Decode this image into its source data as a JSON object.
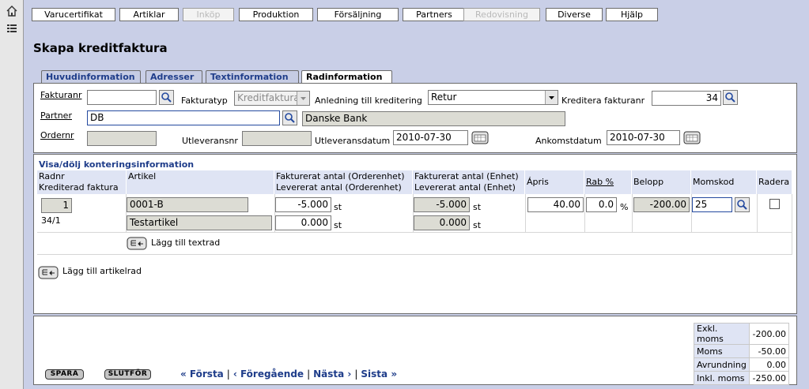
{
  "nav": [
    {
      "label": "Varucertifikat",
      "disabled": false
    },
    {
      "label": "Artiklar",
      "disabled": false
    },
    {
      "label": "Inköp",
      "disabled": true
    },
    {
      "label": "Produktion",
      "disabled": false
    },
    {
      "label": "Försäljning",
      "disabled": false
    },
    {
      "label": "Partners",
      "disabled": false
    },
    {
      "label": "Redovisning",
      "disabled": true
    },
    {
      "label": "Diverse",
      "disabled": false
    },
    {
      "label": "Hjälp",
      "disabled": false
    }
  ],
  "page_title": "Skapa kreditfaktura",
  "tabs": [
    "Huvudinformation",
    "Adresser",
    "Textinformation",
    "Radinformation"
  ],
  "active_tab": "Radinformation",
  "header_form": {
    "fakturanr_label": "Fakturanr",
    "fakturanr_value": "",
    "fakturatyp_label": "Fakturatyp",
    "fakturatyp_value": "Kreditfaktura",
    "anledning_label": "Anledning till kreditering",
    "anledning_value": "Retur",
    "kreditera_label": "Kreditera fakturanr",
    "kreditera_value": "34",
    "partner_label": "Partner",
    "partner_code": "DB",
    "partner_name": "Danske Bank",
    "ordernr_label": "Ordernr",
    "ordernr_value": "",
    "utleveransnr_label": "Utleveransnr",
    "utleveransnr_value": "",
    "utleveransdatum_label": "Utleveransdatum",
    "utleveransdatum_value": "2010-07-30",
    "ankomstdatum_label": "Ankomstdatum",
    "ankomstdatum_value": "2010-07-30"
  },
  "rows_section": {
    "toggle_label": "Visa/dölj konteringsinformation",
    "headers": {
      "radnr": "Radnr",
      "krediterad": "Krediterad faktura",
      "artikel": "Artikel",
      "fakt_orderenhet": "Fakturerat antal (Orderenhet)",
      "lev_orderenhet": "Levererat antal (Orderenhet)",
      "fakt_enhet": "Fakturerat antal (Enhet)",
      "lev_enhet": "Levererat antal (Enhet)",
      "apris": "Ápris",
      "rab": "Rab %",
      "belopp": "Belopp",
      "momskod": "Momskod",
      "radera": "Radera"
    },
    "row": {
      "radnr": "1",
      "krediterad": "34/1",
      "artikel_code": "0001-B",
      "artikel_name": "Testartikel",
      "fakt_orderenhet": "-5.000",
      "lev_orderenhet": "0.000",
      "fakt_enhet": "-5.000",
      "lev_enhet": "0.000",
      "unit": "st",
      "apris": "40.00",
      "rab": "0.0",
      "rab_unit": "%",
      "belopp": "-200.00",
      "momskod": "25"
    },
    "add_textrow": "Lägg till textrad",
    "add_articlerow": "Lägg till artikelrad"
  },
  "footer": {
    "spara": "SPARA",
    "slutfor": "SLUTFÖR",
    "first": "« Första",
    "prev": "‹ Föregående",
    "next": "Nästa ›",
    "last": "Sista »",
    "totals": [
      {
        "label": "Exkl. moms",
        "value": "-200.00"
      },
      {
        "label": "Moms",
        "value": "-50.00"
      },
      {
        "label": "Avrundning",
        "value": "0.00"
      },
      {
        "label": "Inkl. moms",
        "value": "-250.00"
      }
    ]
  }
}
